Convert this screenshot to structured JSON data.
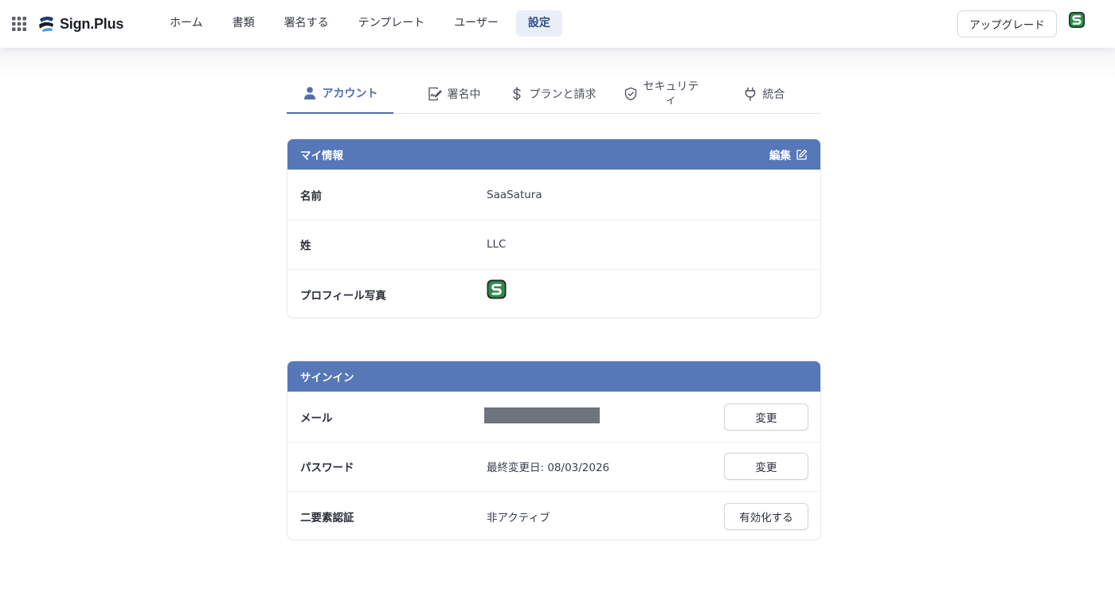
{
  "header": {
    "apps_icon": "grid-apps-icon",
    "logo_text": "Sign.Plus",
    "nav": [
      {
        "label": "ホーム",
        "active": false
      },
      {
        "label": "書類",
        "active": false
      },
      {
        "label": "署名する",
        "active": false
      },
      {
        "label": "テンプレート",
        "active": false
      },
      {
        "label": "ユーザー",
        "active": false
      },
      {
        "label": "設定",
        "active": true
      }
    ],
    "upgrade_label": "アップグレード"
  },
  "tabs": [
    {
      "label": "アカウント",
      "icon": "user-icon",
      "active": true
    },
    {
      "label": "署名中",
      "icon": "signature-icon",
      "active": false
    },
    {
      "label": "プランと請求",
      "icon": "dollar-icon",
      "active": false
    },
    {
      "label": "セキュリティ",
      "label_line1": "セキュリテ",
      "label_line2": "ィ",
      "icon": "shield-check-icon",
      "active": false
    },
    {
      "label": "統合",
      "icon": "plug-icon",
      "active": false
    }
  ],
  "my_info": {
    "title": "マイ情報",
    "edit_label": "編集",
    "rows": [
      {
        "label": "名前",
        "value": "SaaSatura"
      },
      {
        "label": "姓",
        "value": "LLC"
      },
      {
        "label": "プロフィール写真",
        "value": ""
      }
    ]
  },
  "signin": {
    "title": "サインイン",
    "rows": [
      {
        "label": "メール",
        "value": "",
        "button": "変更"
      },
      {
        "label": "パスワード",
        "value": "最終変更日: 08/03/2026",
        "button": "変更"
      },
      {
        "label": "二要素認証",
        "value": "非アクティブ",
        "button": "有効化する"
      }
    ]
  },
  "colors": {
    "accent": "#5677b8",
    "nav_active_bg": "#eaeff7",
    "redaction": "#6f737c"
  }
}
